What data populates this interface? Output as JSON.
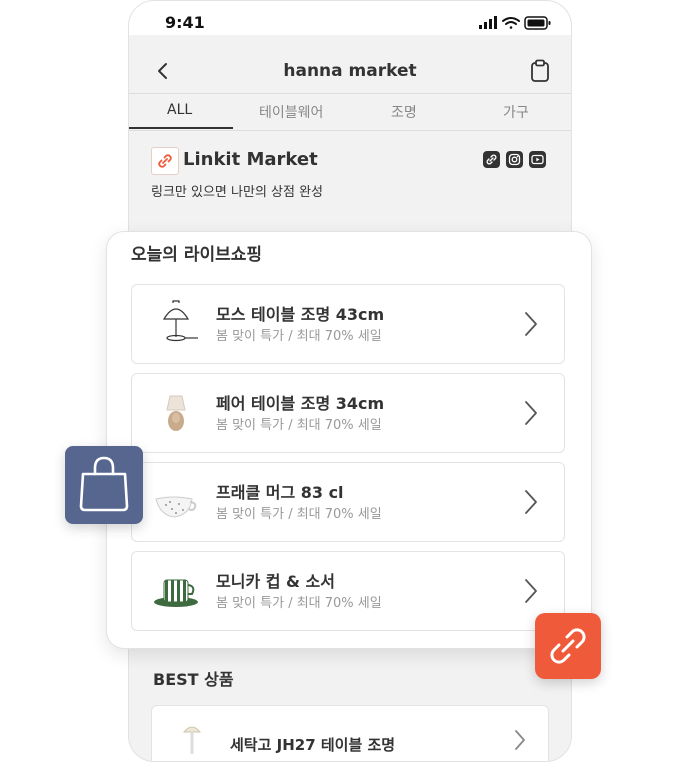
{
  "status_bar": {
    "time": "9:41"
  },
  "header": {
    "title": "hanna market"
  },
  "tabs": [
    {
      "label": "ALL",
      "active": true
    },
    {
      "label": "테이블웨어",
      "active": false
    },
    {
      "label": "조명",
      "active": false
    },
    {
      "label": "가구",
      "active": false
    }
  ],
  "profile": {
    "name": "Linkit Market",
    "tagline": "링크만 있으면 나만의 상점 완성",
    "social_icons": [
      "link-icon",
      "instagram-icon",
      "youtube-icon"
    ]
  },
  "live_shopping": {
    "title": "오늘의 라이브쇼핑",
    "items": [
      {
        "name": "모스 테이블 조명 43cm",
        "subtitle": "봄 맞이 특가 / 최대 70% 세일",
        "thumb": "lamp"
      },
      {
        "name": "페어 테이블 조명 34cm",
        "subtitle": "봄 맞이 특가 / 최대 70% 세일",
        "thumb": "lamp-beige"
      },
      {
        "name": "프래클 머그 83 cl",
        "subtitle": "봄 맞이 특가 / 최대 70% 세일",
        "thumb": "mug"
      },
      {
        "name": "모니카 컵 & 소서",
        "subtitle": "봄 맞이 특가 / 최대 70% 세일",
        "thumb": "cup-saucer"
      }
    ]
  },
  "best": {
    "title": "BEST 상품",
    "items": [
      {
        "name": "세탁고 JH27 테이블 조명"
      }
    ]
  },
  "colors": {
    "accent_blue": "#56668f",
    "accent_orange": "#ef5b3a",
    "background": "#f2f2f2"
  }
}
